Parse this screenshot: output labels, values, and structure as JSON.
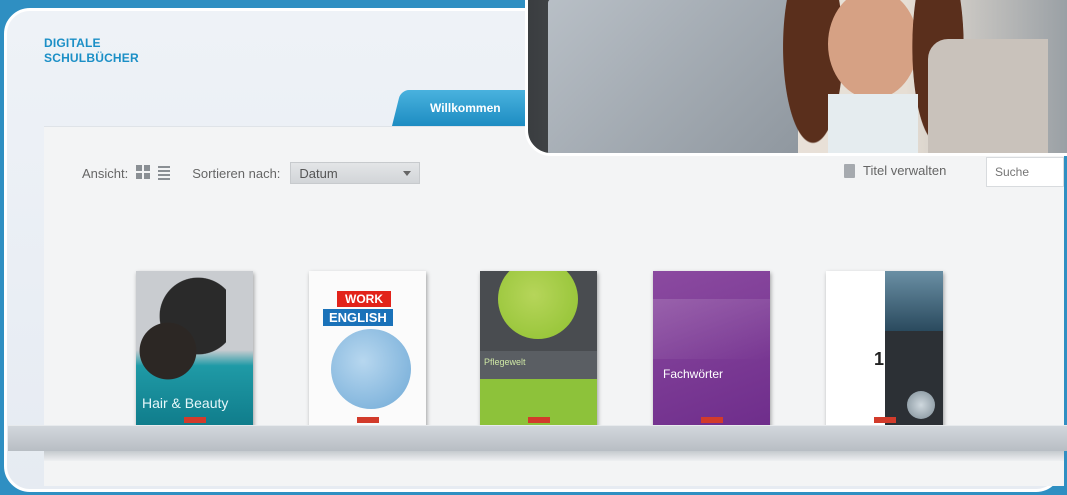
{
  "brand": {
    "line1": "DIGITALE",
    "line2": "SCHULBÜCHER"
  },
  "tabs": [
    {
      "label": "Willkommen"
    }
  ],
  "toolbar": {
    "view_label": "Ansicht:",
    "sort_label": "Sortieren nach:",
    "sort_value": "Datum",
    "manage_label": "Titel verwalten",
    "search_placeholder": "Suche"
  },
  "books": [
    {
      "title": "Hair & Beauty"
    },
    {
      "title_top": "WORK",
      "title_bottom": "ENGLISH"
    },
    {
      "title": "Pflegewelt"
    },
    {
      "title": "Fachwörter"
    },
    {
      "title": "1"
    }
  ],
  "colors": {
    "accent": "#1b8fc6",
    "tab": "#2b9ad0",
    "background": "#2f8fc2"
  }
}
